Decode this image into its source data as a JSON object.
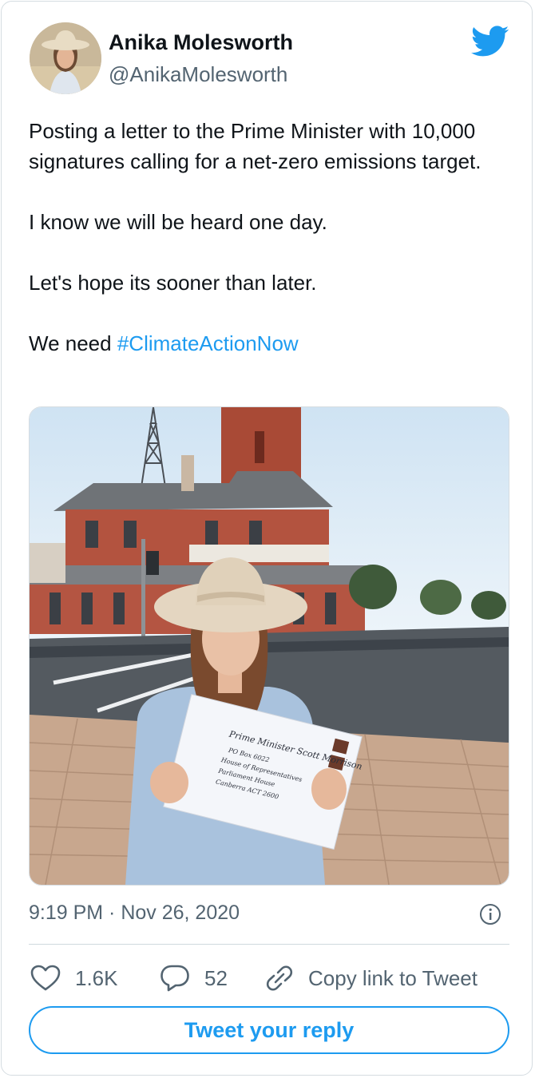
{
  "author": {
    "name": "Anika Molesworth",
    "handle": "@AnikaMolesworth"
  },
  "tweet": {
    "paragraphs": [
      "Posting a letter to the Prime Minister with 10,000 signatures calling for a net-zero emissions target.",
      "I know we will be heard one day.",
      "Let's hope its sooner than later."
    ],
    "last_line_prefix": "We need ",
    "hashtag": "#ClimateActionNow"
  },
  "envelope": {
    "line1": "Prime Minister Scott Morrison",
    "line2": "PO Box 6022",
    "line3": "House of Representatives",
    "line4": "Parliament House",
    "line5": "Canberra  ACT  2600"
  },
  "meta": {
    "timestamp": "9:19 PM · Nov 26, 2020"
  },
  "actions": {
    "likes": "1.6K",
    "replies": "52",
    "copy_link": "Copy link to Tweet"
  },
  "reply_button": "Tweet your reply",
  "icons": {
    "brand": "twitter-bird-icon",
    "info": "info-icon",
    "like": "heart-icon",
    "reply": "speech-bubble-icon",
    "copy": "link-icon"
  },
  "colors": {
    "accent": "#1d9bf0",
    "text": "#0f1419",
    "secondary": "#536471",
    "border": "#d5dce1"
  }
}
